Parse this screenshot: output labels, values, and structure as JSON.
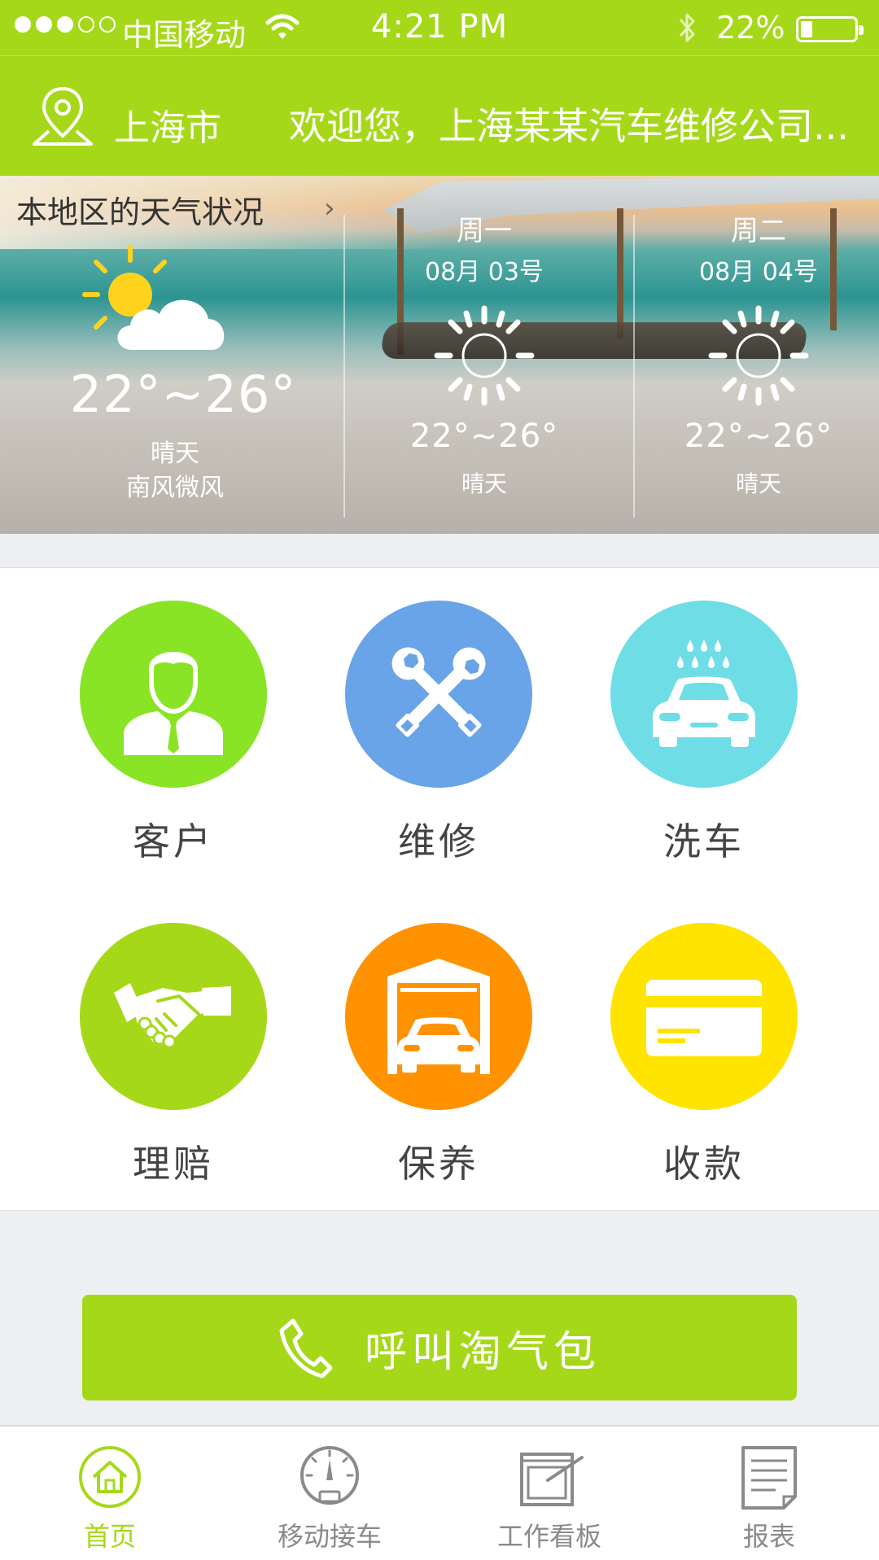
{
  "status_bar": {
    "carrier": "中国移动",
    "time": "4:21 PM",
    "battery_percent": "22%",
    "battery_level": 0.22,
    "signal_bars_filled": 3,
    "signal_bars_total": 5
  },
  "header": {
    "location_icon": "map-pin-icon",
    "city": "上海市",
    "welcome": "欢迎您，上海某某汽车维修公司..."
  },
  "weather": {
    "title": "本地区的天气状况",
    "today": {
      "icon": "sun-cloud-icon",
      "range": "22°~26°",
      "condition": "晴天",
      "wind": "南风微风"
    },
    "days": [
      {
        "day": "周一",
        "date": "08月 03号",
        "icon": "sun-icon",
        "range": "22°~26°",
        "condition": "晴天"
      },
      {
        "day": "周二",
        "date": "08月 04号",
        "icon": "sun-icon",
        "range": "22°~26°",
        "condition": "晴天"
      }
    ]
  },
  "grid": {
    "items": [
      {
        "label": "客户",
        "icon": "customer-icon",
        "color": "#8ae426"
      },
      {
        "label": "维修",
        "icon": "wrench-icon",
        "color": "#6aa4e8"
      },
      {
        "label": "洗车",
        "icon": "car-wash-icon",
        "color": "#6fdde6"
      },
      {
        "label": "理赔",
        "icon": "handshake-icon",
        "color": "#a6d81a"
      },
      {
        "label": "保养",
        "icon": "garage-icon",
        "color": "#ff9200"
      },
      {
        "label": "收款",
        "icon": "card-icon",
        "color": "#ffe400"
      }
    ]
  },
  "call_button": {
    "icon": "phone-icon",
    "label": "呼叫淘气包"
  },
  "tabs": [
    {
      "label": "首页",
      "icon": "home-icon",
      "active": true
    },
    {
      "label": "移动接车",
      "icon": "speedometer-icon",
      "active": false
    },
    {
      "label": "工作看板",
      "icon": "board-icon",
      "active": false
    },
    {
      "label": "报表",
      "icon": "report-icon",
      "active": false
    }
  ],
  "colors": {
    "brand_green": "#a6d81a",
    "tab_inactive": "#8a8a8a",
    "page_bg": "#eeeff2"
  }
}
